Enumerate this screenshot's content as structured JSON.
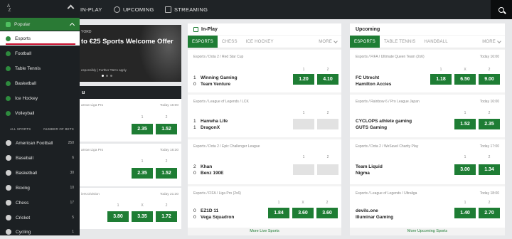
{
  "topnav": {
    "inplay": "IN-PLAY",
    "upcoming": "UPCOMING",
    "streaming": "STREAMING"
  },
  "sidebar": {
    "az": "A\nZ",
    "popular": "Popular",
    "popular_items": [
      {
        "label": "Esports"
      },
      {
        "label": "Football"
      },
      {
        "label": "Table Tennis"
      },
      {
        "label": "Basketball"
      },
      {
        "label": "Ice Hockey"
      },
      {
        "label": "Volleyball"
      }
    ],
    "all_sports": "ALL SPORTS",
    "number_of_bets": "NUMBER OF BETS",
    "sports": [
      {
        "label": "American Football",
        "count": "250"
      },
      {
        "label": "Baseball",
        "count": "6"
      },
      {
        "label": "Basketball",
        "count": "30"
      },
      {
        "label": "Boxing",
        "count": "10"
      },
      {
        "label": "Chess",
        "count": "17"
      },
      {
        "label": "Cricket",
        "count": "5"
      },
      {
        "label": "Cycling",
        "count": "1"
      }
    ]
  },
  "promo": {
    "tag": "YORD",
    "title": "to €25 Sports Welcome Offer",
    "terms": "esponsibly | Further T&Cs apply"
  },
  "left": {
    "header": "u",
    "cards": [
      {
        "league": "arrow Liga Pro",
        "time": "Today 16:00",
        "h": [
          "1",
          "2"
        ],
        "odds": [
          "2.35",
          "1.52"
        ]
      },
      {
        "league": "arrow Liga Pro",
        "time": "Today 16:30",
        "h": [
          "1",
          "2"
        ],
        "odds": [
          "2.35",
          "1.52"
        ]
      },
      {
        "league": "iers Division",
        "time": "Today 21:30",
        "h": [
          "1",
          "X",
          "2"
        ],
        "odds": [
          "3.80",
          "3.35",
          "1.72"
        ]
      }
    ]
  },
  "inplay": {
    "title": "In-Play",
    "tabs": [
      "ESPORTS",
      "CHESS",
      "ICE HOCKEY",
      "MORE"
    ],
    "events": [
      {
        "league": "Esports / Dota 2 / Red Star Cup",
        "time": "",
        "s1": "1",
        "t1": "Winning Gaming",
        "s2": "0",
        "t2": "Team Venture",
        "h": [
          "1",
          "2"
        ],
        "odds": [
          "1.20",
          "4.10"
        ]
      },
      {
        "league": "Esports / League of Legends / LCK",
        "time": "",
        "s1": "1",
        "t1": "Hanwha Life",
        "s2": "1",
        "t2": "DragonX",
        "h": [
          "1",
          "2"
        ],
        "odds": [
          "",
          ""
        ]
      },
      {
        "league": "Esports / Dota 2 / Epic Challenger League",
        "time": "",
        "s1": "2",
        "t1": "Khan",
        "s2": "0",
        "t2": "Benz 190E",
        "h": [
          "1",
          "2"
        ],
        "odds": [
          "",
          ""
        ]
      },
      {
        "league": "Esports / FIFA / Liga Pro (2x6)",
        "time": "",
        "s1": "0",
        "t1": "EZ1D 11",
        "s2": "0",
        "t2": "Vega Squadron",
        "h": [
          "1",
          "X",
          "2"
        ],
        "odds": [
          "1.84",
          "3.60",
          "3.60"
        ]
      }
    ],
    "more": "More Live Sports"
  },
  "upcoming": {
    "title": "Upcoming",
    "tabs": [
      "ESPORTS",
      "TABLE TENNIS",
      "HANDBALL",
      "MORE"
    ],
    "events": [
      {
        "league": "Esports / FIFA / Ultimate Queen Team (2x6)",
        "time": "Today 16:00",
        "t1": "FC Utrecht",
        "t2": "Hamilton Accies",
        "h": [
          "1",
          "X",
          "2"
        ],
        "odds": [
          "1.18",
          "6.50",
          "9.00"
        ]
      },
      {
        "league": "Esports / Rainbow 6 / Pro League Japan",
        "time": "Today 16:00",
        "t1": "CYCLOPS athlete gaming",
        "t2": "GUTS Gaming",
        "h": [
          "1",
          "2"
        ],
        "odds": [
          "1.52",
          "2.35"
        ]
      },
      {
        "league": "Esports / Dota 2 / WeSavel Charity Play",
        "time": "Today 17:00",
        "t1": "Team Liquid",
        "t2": "Nigma",
        "h": [
          "1",
          "2"
        ],
        "odds": [
          "3.00",
          "1.34"
        ]
      },
      {
        "league": "Esports / League of Legends / Ultraliga",
        "time": "Today 18:00",
        "t1": "devils.one",
        "t2": "Illuminar Gaming",
        "h": [
          "1",
          "2"
        ],
        "odds": [
          "1.40",
          "2.70"
        ]
      }
    ],
    "more": "More Upcoming Sports"
  }
}
